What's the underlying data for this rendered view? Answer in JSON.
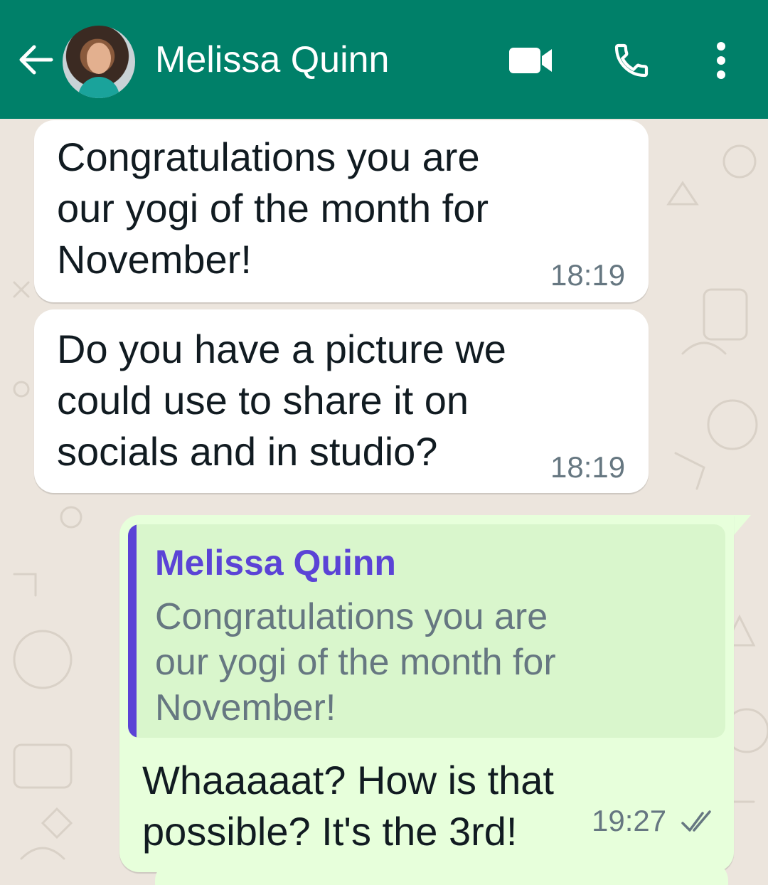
{
  "header": {
    "contact_name": "Melissa Quinn",
    "icons": [
      "back-arrow-icon",
      "contact-avatar",
      "video-call-icon",
      "voice-call-icon",
      "more-options-icon"
    ],
    "background_color": "#008069"
  },
  "messages": [
    {
      "direction": "incoming",
      "lines": [
        "Congratulations you are",
        "our yogi of the month for",
        "November!"
      ],
      "time": "18:19"
    },
    {
      "direction": "incoming",
      "lines": [
        "Do you have a picture we",
        "could use to share it on",
        "socials and in studio?"
      ],
      "time": "18:19"
    },
    {
      "direction": "outgoing",
      "quote": {
        "author": "Melissa Quinn",
        "lines": [
          "Congratulations you are",
          "our yogi of the month for",
          "November!"
        ]
      },
      "lines": [
        "Whaaaaat? How is that",
        "possible? It's the 3rd!"
      ],
      "time": "19:27",
      "status": "read"
    }
  ],
  "colors": {
    "incoming_bubble": "#ffffff",
    "outgoing_bubble": "#e7ffdb",
    "quote_accent": "#5b43d6",
    "read_ticks": "#667781"
  }
}
